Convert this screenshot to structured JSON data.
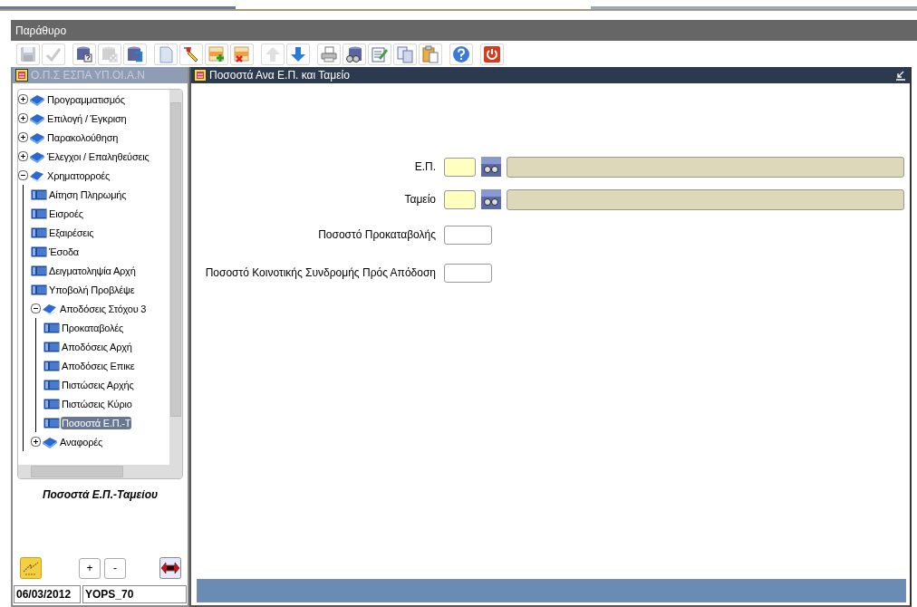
{
  "menu_bar": {
    "items": [
      {
        "label": "Παράθυρο"
      }
    ]
  },
  "toolbar": [
    {
      "kind": "save",
      "disabled": true
    },
    {
      "kind": "check",
      "disabled": true
    },
    {
      "kind": "db-query",
      "disabled": false
    },
    {
      "kind": "db-delete",
      "disabled": true
    },
    {
      "kind": "db-edit",
      "disabled": false
    },
    {
      "kind": "page",
      "disabled": false
    },
    {
      "kind": "pencil",
      "disabled": false
    },
    {
      "kind": "row-add",
      "disabled": false
    },
    {
      "kind": "row-delete",
      "disabled": false
    },
    {
      "kind": "up",
      "disabled": true
    },
    {
      "kind": "down",
      "disabled": false
    },
    {
      "kind": "printer",
      "disabled": false
    },
    {
      "kind": "db-search",
      "disabled": false
    },
    {
      "kind": "notepad",
      "disabled": false
    },
    {
      "kind": "copy",
      "disabled": false
    },
    {
      "kind": "paste",
      "disabled": false
    },
    {
      "kind": "help",
      "disabled": false
    },
    {
      "kind": "power",
      "disabled": false
    }
  ],
  "navigator": {
    "title": "Ο.Π.Σ ΕΣΠΑ ΥΠ.ΟΙ.Α.Ν",
    "active": false,
    "tree": [
      {
        "label": "Προγραμματισμός",
        "kind": "folder",
        "expanded": false,
        "selected": false
      },
      {
        "label": "Επιλογή / Έγκριση",
        "kind": "folder",
        "expanded": false,
        "selected": false
      },
      {
        "label": "Παρακολούθηση",
        "kind": "folder",
        "expanded": false,
        "selected": false
      },
      {
        "label": "Έλεγχοι / Επαληθεύσεις",
        "kind": "folder",
        "expanded": false,
        "selected": false
      },
      {
        "label": "Χρηματορροές",
        "kind": "folder",
        "expanded": true,
        "selected": false,
        "children": [
          {
            "label": "Αίτηση Πληρωμής",
            "kind": "form",
            "selected": false
          },
          {
            "label": "Εισροές",
            "kind": "form",
            "selected": false
          },
          {
            "label": "Εξαιρέσεις",
            "kind": "form",
            "selected": false
          },
          {
            "label": "Έσοδα",
            "kind": "form",
            "selected": false
          },
          {
            "label": "Δειγματοληψία Αρχή",
            "kind": "form",
            "selected": false
          },
          {
            "label": "Υποβολή Προβλέψε",
            "kind": "form",
            "selected": false
          },
          {
            "label": "Αποδόσεις Στόχου 3",
            "kind": "folder",
            "expanded": true,
            "selected": false,
            "children": [
              {
                "label": "Προκαταβολές",
                "kind": "form",
                "selected": false
              },
              {
                "label": "Αποδόσεις Αρχή",
                "kind": "form",
                "selected": false
              },
              {
                "label": "Αποδόσεις Επικε",
                "kind": "form",
                "selected": false
              },
              {
                "label": "Πιστώσεις Αρχής",
                "kind": "form",
                "selected": false
              },
              {
                "label": "Πιστώσεις Κύριο",
                "kind": "form",
                "selected": false
              },
              {
                "label": "Ποσοστά Ε.Π.-Τ",
                "kind": "form",
                "selected": true
              }
            ]
          },
          {
            "label": "Αναφορές",
            "kind": "folder",
            "expanded": false,
            "selected": false
          }
        ]
      }
    ],
    "caption": "Ποσοστά Ε.Π.-Ταμείου",
    "buttons": [
      {
        "kind": "tool"
      },
      {
        "kind": "text",
        "label": "+"
      },
      {
        "kind": "text",
        "label": "-"
      },
      {
        "kind": "exit"
      }
    ],
    "status": [
      "06/03/2012",
      "YOPS_70"
    ]
  },
  "form_window": {
    "title": "Ποσοστά Ανα Ε.Π. και Ταμείο",
    "active": true,
    "fields": [
      {
        "label": "Ε.Π.",
        "kind": "lookup"
      },
      {
        "label": "Ταμείο",
        "kind": "lookup"
      },
      {
        "label": "Ποσοστό Προκαταβολής",
        "kind": "number"
      },
      {
        "label": "Ποσοστό Κοινοτικής Συνδρομής Πρός Απόδοση",
        "kind": "number"
      }
    ]
  }
}
